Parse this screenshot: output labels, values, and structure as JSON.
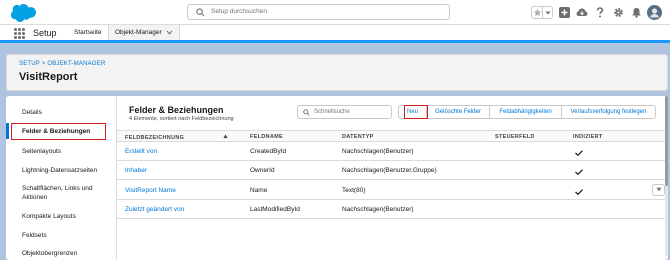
{
  "header": {
    "search_placeholder": "Setup durchsuchen",
    "icons": [
      "star-icon",
      "chevron-down-icon",
      "plus-icon",
      "cloud-icon",
      "help-icon",
      "gear-icon",
      "bell-icon",
      "avatar-icon"
    ]
  },
  "app_nav": {
    "app_name": "Setup",
    "tabs": [
      {
        "label": "Startseite"
      },
      {
        "label": "Objekt-Manager"
      }
    ]
  },
  "object_header": {
    "breadcrumb": "SETUP > OBJEKT-MANAGER",
    "title": "VisitReport"
  },
  "sidebar": {
    "items": [
      {
        "label": "Details"
      },
      {
        "label": "Felder & Beziehungen",
        "active": true
      },
      {
        "label": "Seitenlayouts"
      },
      {
        "label": "Lightning-Datensatzseiten"
      },
      {
        "label": "Schaltflächen, Links und Aktionen"
      },
      {
        "label": "Kompakte Layouts"
      },
      {
        "label": "Feldsets"
      },
      {
        "label": "Objektobergrenzen"
      }
    ]
  },
  "main": {
    "title": "Felder & Beziehungen",
    "subtitle": "4 Elemente, sortiert nach Feldbezeichnung",
    "quick_search_placeholder": "Schnellsuche",
    "buttons": [
      {
        "label": "Neu"
      },
      {
        "label": "Gelöschte Felder"
      },
      {
        "label": "Feldabhängigkeiten"
      },
      {
        "label": "Verlaufsverfolgung festlegen"
      }
    ],
    "columns": [
      "FELDBEZEICHNUNG",
      "FELDNAME",
      "DATENTYP",
      "STEUERFELD",
      "INDIZIERT"
    ],
    "rows": [
      {
        "label": "Erstellt von",
        "name": "CreatedById",
        "type": "Nachschlagen(Benutzer)",
        "controlling": "",
        "indexed": true
      },
      {
        "label": "Inhaber",
        "name": "OwnerId",
        "type": "Nachschlagen(Benutzer,Gruppe)",
        "controlling": "",
        "indexed": true
      },
      {
        "label": "VisitReport Name",
        "name": "Name",
        "type": "Text(80)",
        "controlling": "",
        "indexed": true
      },
      {
        "label": "Zuletzt geändert von",
        "name": "LastModifiedById",
        "type": "Nachschlagen(Benutzer)",
        "controlling": "",
        "indexed": false
      }
    ]
  },
  "colors": {
    "brand_blue": "#0176d3",
    "highlight_red": "#d0201d",
    "background": "#b0c4df"
  }
}
